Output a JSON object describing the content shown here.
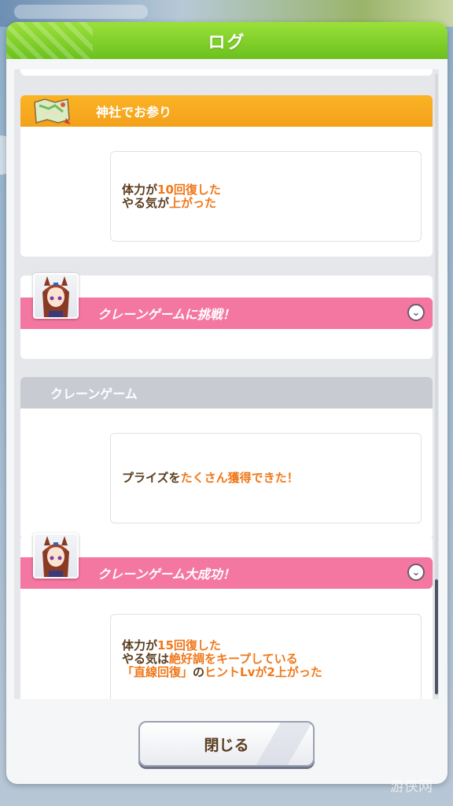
{
  "dialog": {
    "title": "ログ"
  },
  "entries": [
    {
      "title": "神社でお参り",
      "lines": [
        [
          {
            "t": "体力が"
          },
          {
            "t": "10回復した",
            "o": true
          }
        ],
        [
          {
            "t": "やる気が"
          },
          {
            "t": "上がった",
            "o": true
          }
        ]
      ]
    },
    {
      "title": "クレーンゲームに挑戦！"
    },
    {
      "title": "クレーンゲーム",
      "lines": [
        [
          {
            "t": "プライズを"
          },
          {
            "t": "たくさん獲得できた！",
            "o": true
          }
        ]
      ]
    },
    {
      "title": "クレーンゲーム大成功！",
      "lines": [
        [
          {
            "t": "体力が"
          },
          {
            "t": "15回復した",
            "o": true
          }
        ],
        [
          {
            "t": "やる気は"
          },
          {
            "t": "絶好調をキープしている",
            "o": true
          }
        ],
        [
          {
            "t": "「直線回復」",
            "o": true
          },
          {
            "t": "の"
          },
          {
            "t": "ヒントLvが2上がった",
            "o": true
          }
        ]
      ]
    }
  ],
  "close_button": {
    "label": "閉じる"
  },
  "watermark": "游侠网",
  "colors": {
    "header_green": "#7bd12a",
    "orange_bar": "#f7a91f",
    "pink_bar": "#f477a2",
    "gray_bar": "#c9cbd3",
    "highlight": "#f0781a",
    "text_brown": "#5a3d1f"
  },
  "icons": {
    "entry0": "map-icon",
    "entry1": "character-portrait",
    "entry3": "character-portrait",
    "expand": "chevron-down-icon"
  }
}
